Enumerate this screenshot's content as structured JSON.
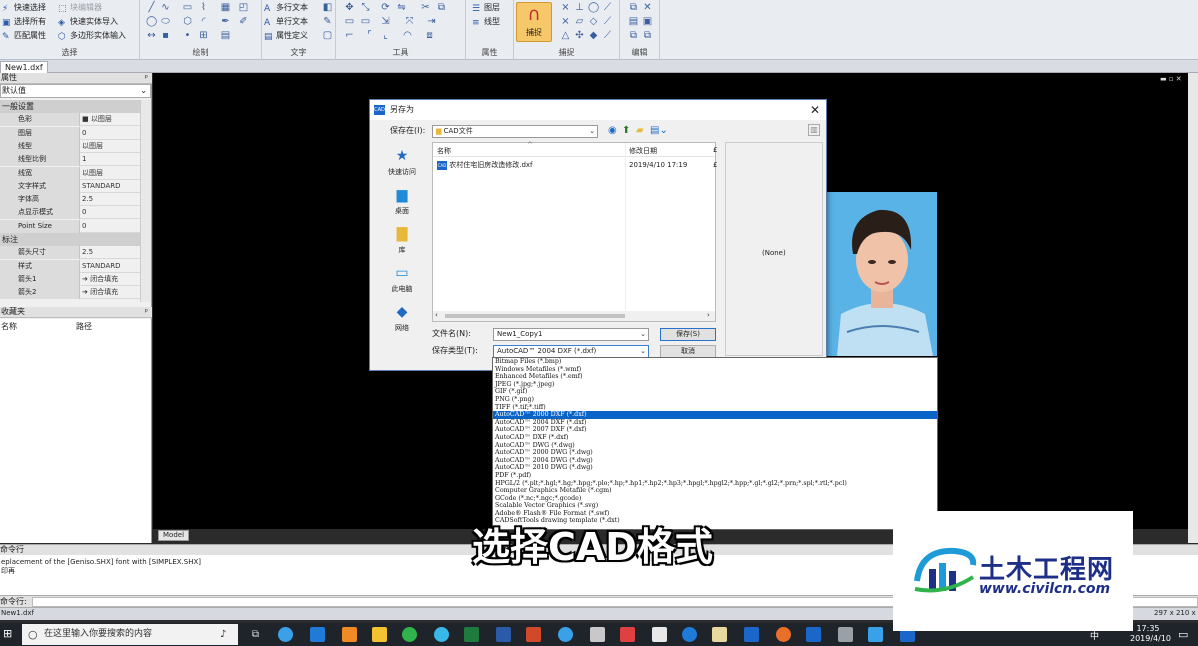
{
  "ribbon": {
    "select_group": {
      "label": "选择",
      "items": [
        "快速选择",
        "选择所有",
        "匹配属性"
      ],
      "items2": [
        "块编辑器",
        "快速实体导入",
        "多边形实体输入"
      ]
    },
    "draw_group": {
      "label": "绘制"
    },
    "text_group": {
      "label": "文字",
      "items": [
        "多行文本",
        "单行文本",
        "属性定义"
      ]
    },
    "tools_group": {
      "label": "工具"
    },
    "props_group": {
      "label": "属性",
      "items": [
        "图层",
        "线型"
      ]
    },
    "snap_group": {
      "label": "捕捉",
      "snap_button": "捕捉"
    },
    "edit_group": {
      "label": "编辑"
    }
  },
  "file_tab": "New1.dxf",
  "properties_panel": {
    "title": "属性",
    "combo": "默认值",
    "rows": [
      {
        "section": true,
        "label": "一般设置"
      },
      {
        "key": "色彩",
        "value": "■ 以图层"
      },
      {
        "key": "图层",
        "value": "0"
      },
      {
        "key": "线型",
        "value": "以图层"
      },
      {
        "key": "线型比例",
        "value": "1"
      },
      {
        "key": "线宽",
        "value": "以图层"
      },
      {
        "key": "文字样式",
        "value": "STANDARD"
      },
      {
        "key": "字体高",
        "value": "2.5"
      },
      {
        "key": "点显示模式",
        "value": "0"
      },
      {
        "key": "Point Size",
        "value": "0"
      },
      {
        "section": true,
        "label": "标注"
      },
      {
        "key": "箭头尺寸",
        "value": "2.5"
      },
      {
        "key": "样式",
        "value": "STANDARD"
      },
      {
        "key": "箭头1",
        "value": "➔ 闭合填充"
      },
      {
        "key": "箭头2",
        "value": "➔ 闭合填充"
      }
    ]
  },
  "favorites_panel": {
    "title": "收藏夹",
    "col_name": "名称",
    "col_path": "路径"
  },
  "model_tab": "Model",
  "command": {
    "title": "命令行",
    "log": [
      "eplacement of the [Geniso.SHX] font with [SIMPLEX.SHX]",
      "印再"
    ],
    "prompt": "命令行:"
  },
  "status": {
    "file": "New1.dxf",
    "paper": "297 x 210 x 0"
  },
  "dialog": {
    "title": "另存为",
    "save_in_label": "保存在(I):",
    "save_in_value": "CAD文件",
    "places": [
      "快速访问",
      "桌面",
      "库",
      "此电脑",
      "网络"
    ],
    "col_name": "名称",
    "col_date": "修改日期",
    "col_extra": "£",
    "file_name": "农村住宅旧房改造修改.dxf",
    "file_date": "2019/4/10 17:19",
    "file_type_badge": "CAD",
    "preview_text": "(None)",
    "filename_label": "文件名(N):",
    "filename_value": "New1_Copy1",
    "filetype_label": "保存类型(T):",
    "filetype_value": "AutoCAD™ 2004 DXF (*.dxf)",
    "save_button": "保存(S)",
    "cancel_button": "取消"
  },
  "dropdown": {
    "selected_index": 7,
    "options": [
      "Bitmap Files (*.bmp)",
      "Windows Metafiles (*.wmf)",
      "Enhanced Metafiles (*.emf)",
      "JPEG (*.jpg;*.jpeg)",
      "GIF (*.gif)",
      "PNG (*.png)",
      "TIFF (*.tif;*.tiff)",
      "AutoCAD™ 2000 DXF (*.dxf)",
      "AutoCAD™ 2004 DXF (*.dxf)",
      "AutoCAD™ 2007 DXF (*.dxf)",
      "AutoCAD™ DXF (*.dxf)",
      "AutoCAD™ DWG (*.dwg)",
      "AutoCAD™ 2000 DWG (*.dwg)",
      "AutoCAD™ 2004 DWG (*.dwg)",
      "AutoCAD™ 2010 DWG (*.dwg)",
      "PDF (*.pdf)",
      "HPGL/2 (*.plt;*.hgl;*.hg;*.hpg;*.plo;*.hp;*.hp1;*.hp2;*.hp3;*.hpgl;*.hpgl2;*.hpp;*.gl;*.gl2;*.prn;*.spl;*.rtl;*.pcl)",
      "Computer Graphics Metafile (*.cgm)",
      "GCode (*.nc;*.ngc;*.gcode)",
      "Scalable Vector Graphics (*.svg)",
      "Adobe® Flash® File Format (*.swf)",
      "CADSoftTools drawing template (*.dxt)"
    ]
  },
  "subtitle": "选择CAD格式",
  "watermark": {
    "name": "土木工程网",
    "url": "www.civilcn.com"
  },
  "taskbar": {
    "search_placeholder": "在这里输入你要搜索的内容",
    "time": "17:35",
    "date": "2019/4/10",
    "ime": "中"
  },
  "colors": {
    "accent": "#0a64c8",
    "canvas": "#000000",
    "snap_button": "#f6c86a",
    "watermark_blue": "#1d2f86"
  }
}
